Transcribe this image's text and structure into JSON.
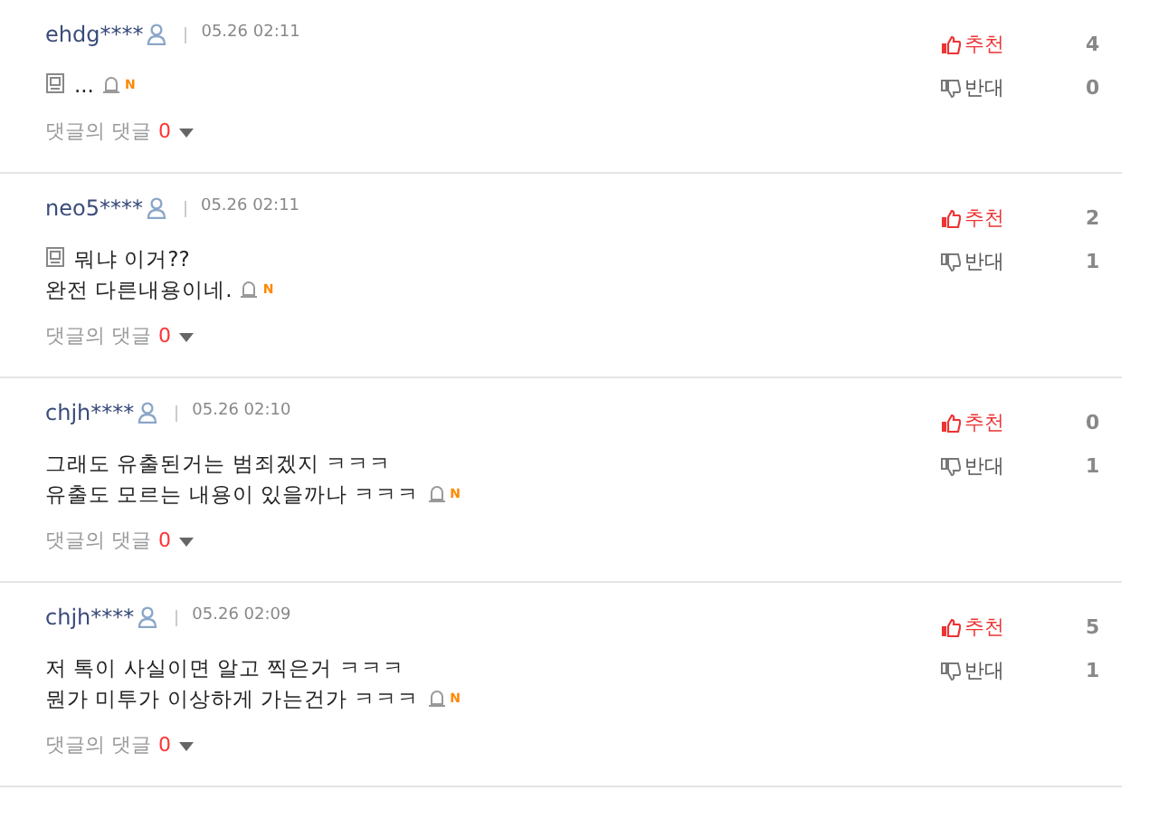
{
  "comments": [
    {
      "user": "ehdg****",
      "time": "05.26 02:11",
      "memo": true,
      "lines": [
        "..."
      ],
      "new_mark": "N",
      "reply_label": "댓글의 댓글",
      "reply_count": "0",
      "up_label": "추천",
      "up_count": "4",
      "down_label": "반대",
      "down_count": "0"
    },
    {
      "user": "neo5****",
      "time": "05.26 02:11",
      "memo": true,
      "lines": [
        "뭐냐 이거??",
        "완전 다른내용이네."
      ],
      "new_mark": "N",
      "reply_label": "댓글의 댓글",
      "reply_count": "0",
      "up_label": "추천",
      "up_count": "2",
      "down_label": "반대",
      "down_count": "1"
    },
    {
      "user": "chjh****",
      "time": "05.26 02:10",
      "memo": false,
      "lines": [
        "그래도 유출된거는 범죄겠지 ㅋㅋㅋ",
        "유출도 모르는 내용이 있을까나 ㅋㅋㅋ"
      ],
      "new_mark": "N",
      "reply_label": "댓글의 댓글",
      "reply_count": "0",
      "up_label": "추천",
      "up_count": "0",
      "down_label": "반대",
      "down_count": "1"
    },
    {
      "user": "chjh****",
      "time": "05.26 02:09",
      "memo": false,
      "lines": [
        "저 톡이 사실이면 알고 찍은거 ㅋㅋㅋ",
        "뭔가 미투가 이상하게 가는건가 ㅋㅋㅋ"
      ],
      "new_mark": "N",
      "reply_label": "댓글의 댓글",
      "reply_count": "0",
      "up_label": "추천",
      "up_count": "5",
      "down_label": "반대",
      "down_count": "1"
    }
  ]
}
